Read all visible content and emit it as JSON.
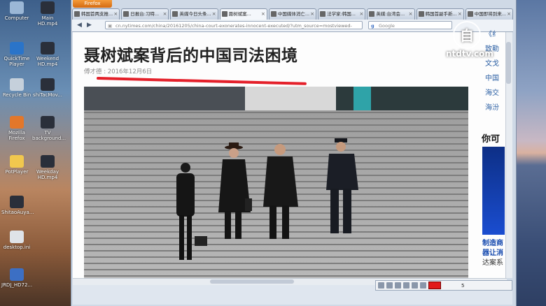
{
  "desktop_icons": [
    {
      "label": "Computer",
      "icon": "computer-icon",
      "color": "#9bb7d6"
    },
    {
      "label": "Main HD.mp4",
      "icon": "video-file-icon",
      "color": "#2a2f3a"
    },
    {
      "label": "QuickTime Player",
      "icon": "quicktime-icon",
      "color": "#2a74c9"
    },
    {
      "label": "Weekend HD.mp4",
      "icon": "video-file-icon",
      "color": "#2a2f3a"
    },
    {
      "label": "Recycle Bin",
      "icon": "recycle-bin-icon",
      "color": "#c5d0db"
    },
    {
      "label": "shiTacMov...",
      "icon": "video-file-icon",
      "color": "#2a2f3a"
    },
    {
      "label": "Mozilla Firefox",
      "icon": "firefox-icon",
      "color": "#e3772a"
    },
    {
      "label": "TV background...",
      "icon": "video-file-icon",
      "color": "#2a2f3a"
    },
    {
      "label": "PotPlayer",
      "icon": "folder-icon",
      "color": "#f1c84e"
    },
    {
      "label": "Weekday HD.mp4",
      "icon": "video-file-icon",
      "color": "#2a2f3a"
    },
    {
      "label": "ShitaoAuya...",
      "icon": "video-file-icon",
      "color": "#2a2f3a"
    },
    {
      "label": "desktop.ini",
      "icon": "ini-file-icon",
      "color": "#dfe3e8"
    },
    {
      "label": "JRDJ_HD72...",
      "icon": "program-icon",
      "color": "#3c6fc4"
    }
  ],
  "browser": {
    "app_button": "Firefox",
    "tabs": [
      {
        "label": "韩国首两支推...",
        "active": false
      },
      {
        "label": "日报台:习特...",
        "active": false
      },
      {
        "label": "英媒今日头条...",
        "active": false
      },
      {
        "label": "聂树斌案...",
        "active": true
      },
      {
        "label": "中国媒体消亡...",
        "active": false
      },
      {
        "label": "法学家:韩国...",
        "active": false
      },
      {
        "label": "英媒:台湾会...",
        "active": false
      },
      {
        "label": "韩国首副手新...",
        "active": false
      },
      {
        "label": "中国即将到来...",
        "active": false
      }
    ],
    "url": "cn.nytimes.com/china/20161205/china-court-exonerates-innocent-executed/?utm_source=mostviewed-",
    "search_placeholder": "Google",
    "watermark_glyph": "自",
    "watermark_text": "ntdtv.com"
  },
  "article": {
    "headline": "聂树斌案背后的中国司法困境",
    "author": "傅才德",
    "date": "2016年12月6日"
  },
  "sidebar": {
    "links": [
      "《纟",
      "致勒",
      "文戈",
      "中国",
      "海交",
      "海汾"
    ],
    "heading": "你可",
    "ad_line1": "制造商",
    "ad_line2": "器让消",
    "ad_line3": "达案系"
  },
  "toolbox": {
    "colors": {
      "pen": "#e21a1a"
    },
    "size_value": "5"
  }
}
